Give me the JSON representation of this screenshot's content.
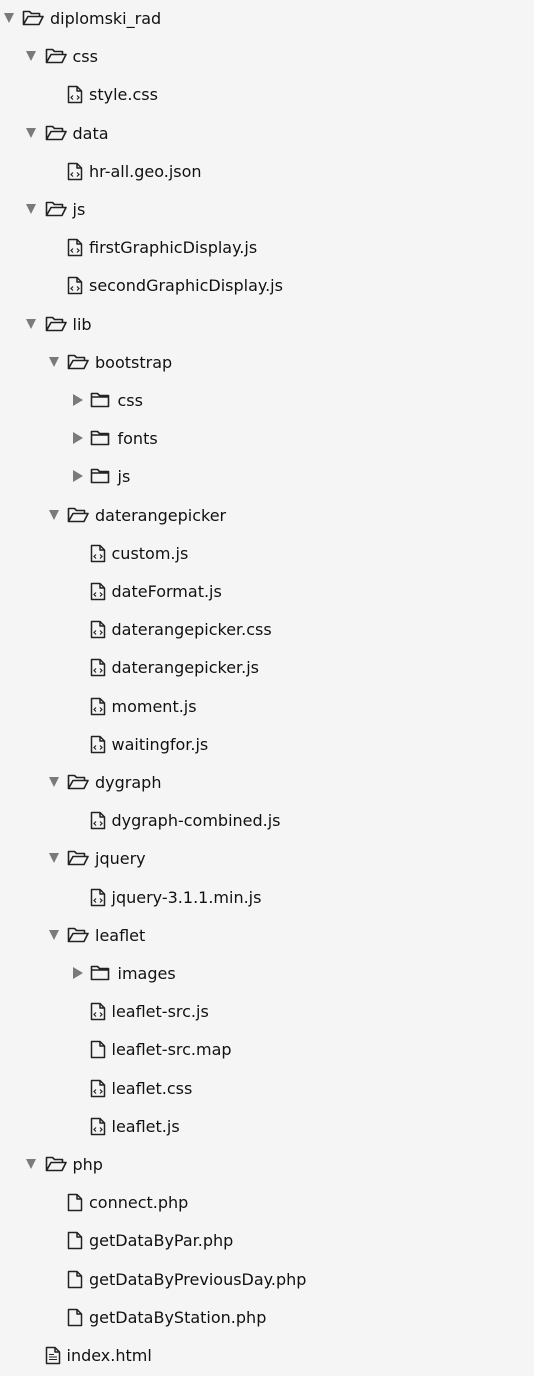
{
  "tree": [
    {
      "label": "diplomski_rad",
      "kind": "folder",
      "depth": 0,
      "expanded": true,
      "icon": "open-folder-icon"
    },
    {
      "label": "css",
      "kind": "folder",
      "depth": 1,
      "expanded": true,
      "icon": "open-folder-icon"
    },
    {
      "label": "style.css",
      "kind": "file",
      "depth": 2,
      "icon": "code-file-icon"
    },
    {
      "label": "data",
      "kind": "folder",
      "depth": 1,
      "expanded": true,
      "icon": "open-folder-icon"
    },
    {
      "label": "hr-all.geo.json",
      "kind": "file",
      "depth": 2,
      "icon": "code-file-icon"
    },
    {
      "label": "js",
      "kind": "folder",
      "depth": 1,
      "expanded": true,
      "icon": "open-folder-icon"
    },
    {
      "label": "firstGraphicDisplay.js",
      "kind": "file",
      "depth": 2,
      "icon": "code-file-icon"
    },
    {
      "label": "secondGraphicDisplay.js",
      "kind": "file",
      "depth": 2,
      "icon": "code-file-icon"
    },
    {
      "label": "lib",
      "kind": "folder",
      "depth": 1,
      "expanded": true,
      "icon": "open-folder-icon"
    },
    {
      "label": "bootstrap",
      "kind": "folder",
      "depth": 2,
      "expanded": true,
      "icon": "open-folder-icon"
    },
    {
      "label": "css",
      "kind": "folder",
      "depth": 3,
      "expanded": false,
      "icon": "folder-icon"
    },
    {
      "label": "fonts",
      "kind": "folder",
      "depth": 3,
      "expanded": false,
      "icon": "folder-icon"
    },
    {
      "label": "js",
      "kind": "folder",
      "depth": 3,
      "expanded": false,
      "icon": "folder-icon"
    },
    {
      "label": "daterangepicker",
      "kind": "folder",
      "depth": 2,
      "expanded": true,
      "icon": "open-folder-icon"
    },
    {
      "label": "custom.js",
      "kind": "file",
      "depth": 3,
      "icon": "code-file-icon"
    },
    {
      "label": "dateFormat.js",
      "kind": "file",
      "depth": 3,
      "icon": "code-file-icon"
    },
    {
      "label": "daterangepicker.css",
      "kind": "file",
      "depth": 3,
      "icon": "code-file-icon"
    },
    {
      "label": "daterangepicker.js",
      "kind": "file",
      "depth": 3,
      "icon": "code-file-icon"
    },
    {
      "label": "moment.js",
      "kind": "file",
      "depth": 3,
      "icon": "code-file-icon"
    },
    {
      "label": "waitingfor.js",
      "kind": "file",
      "depth": 3,
      "icon": "code-file-icon"
    },
    {
      "label": "dygraph",
      "kind": "folder",
      "depth": 2,
      "expanded": true,
      "icon": "open-folder-icon"
    },
    {
      "label": "dygraph-combined.js",
      "kind": "file",
      "depth": 3,
      "icon": "code-file-icon"
    },
    {
      "label": "jquery",
      "kind": "folder",
      "depth": 2,
      "expanded": true,
      "icon": "open-folder-icon"
    },
    {
      "label": "jquery-3.1.1.min.js",
      "kind": "file",
      "depth": 3,
      "icon": "code-file-icon"
    },
    {
      "label": "leaflet",
      "kind": "folder",
      "depth": 2,
      "expanded": true,
      "icon": "open-folder-icon"
    },
    {
      "label": "images",
      "kind": "folder",
      "depth": 3,
      "expanded": false,
      "icon": "folder-icon"
    },
    {
      "label": "leaflet-src.js",
      "kind": "file",
      "depth": 3,
      "icon": "code-file-icon"
    },
    {
      "label": "leaflet-src.map",
      "kind": "file",
      "depth": 3,
      "icon": "blank-file-icon"
    },
    {
      "label": "leaflet.css",
      "kind": "file",
      "depth": 3,
      "icon": "code-file-icon"
    },
    {
      "label": "leaflet.js",
      "kind": "file",
      "depth": 3,
      "icon": "code-file-icon"
    },
    {
      "label": "php",
      "kind": "folder",
      "depth": 1,
      "expanded": true,
      "icon": "open-folder-icon"
    },
    {
      "label": "connect.php",
      "kind": "file",
      "depth": 2,
      "icon": "blank-file-icon"
    },
    {
      "label": "getDataByPar.php",
      "kind": "file",
      "depth": 2,
      "icon": "blank-file-icon"
    },
    {
      "label": "getDataByPreviousDay.php",
      "kind": "file",
      "depth": 2,
      "icon": "blank-file-icon"
    },
    {
      "label": "getDataByStation.php",
      "kind": "file",
      "depth": 2,
      "icon": "blank-file-icon"
    },
    {
      "label": "index.html",
      "kind": "file",
      "depth": 1,
      "icon": "markup-file-icon"
    }
  ],
  "colors": {
    "background": "#f5f5f5",
    "text": "#111111",
    "arrow": "#7a7a7a",
    "icon_stroke": "#222222"
  }
}
